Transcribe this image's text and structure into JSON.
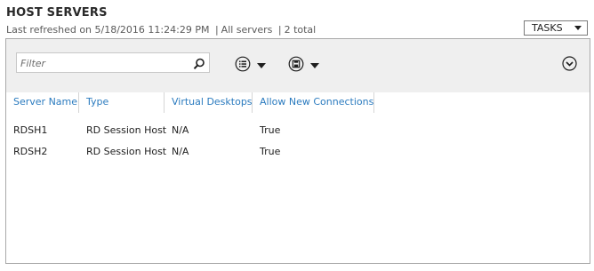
{
  "header": {
    "title": "HOST SERVERS",
    "last_refreshed": "Last refreshed on 5/18/2016 11:24:29 PM",
    "scope": "All servers",
    "count": "2 total",
    "separator": "|"
  },
  "tasks_button": {
    "label": "TASKS"
  },
  "toolbar": {
    "filter_placeholder": "Filter",
    "filter_value": "",
    "icons": [
      "search-icon",
      "list-options-icon",
      "save-icon",
      "collapse-icon"
    ]
  },
  "table": {
    "columns": [
      "Server Name",
      "Type",
      "Virtual Desktops",
      "Allow New Connections"
    ],
    "rows": [
      [
        "RDSH1",
        "RD Session Host",
        "N/A",
        "True"
      ],
      [
        "RDSH2",
        "RD Session Host",
        "N/A",
        "True"
      ]
    ]
  },
  "colors": {
    "header_link": "#2b7bbf",
    "toolbar_bg": "#efefef",
    "border": "#a9a9a9"
  }
}
